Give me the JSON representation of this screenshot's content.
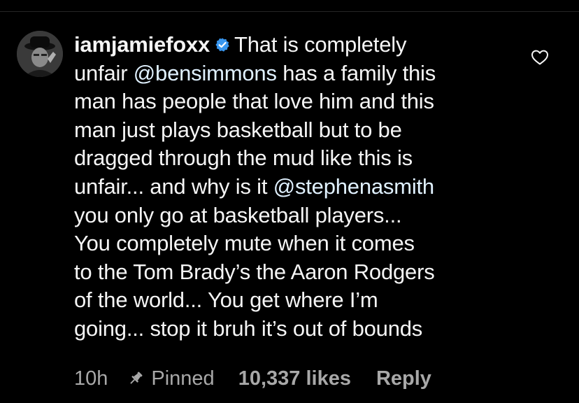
{
  "comment": {
    "username": "iamjamiefoxx",
    "verified_icon": "verified-badge-icon",
    "avatar_icon": "profile-photo",
    "lines": [
      [
        {
          "text": "That is completely"
        }
      ],
      [
        {
          "text": "unfair "
        },
        {
          "text": "@bensimmons",
          "mention": true
        },
        {
          "text": " has a family this"
        }
      ],
      [
        {
          "text": "man has people that love him and this"
        }
      ],
      [
        {
          "text": "man just plays basketball but to be"
        }
      ],
      [
        {
          "text": "dragged through the mud like this is"
        }
      ],
      [
        {
          "text": "unfair... and why is it "
        },
        {
          "text": "@stephenasmith",
          "mention": true
        }
      ],
      [
        {
          "text": "you only go at basketball players..."
        }
      ],
      [
        {
          "text": "You completely mute when it comes"
        }
      ],
      [
        {
          "text": "to the Tom Brady’s the Aaron Rodgers"
        }
      ],
      [
        {
          "text": "of the world... You get where I’m"
        }
      ],
      [
        {
          "text": "going...  stop it bruh it’s out of bounds"
        }
      ]
    ]
  },
  "meta": {
    "time": "10h",
    "pin_icon": "pin-icon",
    "pinned_label": "Pinned",
    "likes_label": "10,337 likes",
    "reply_label": "Reply"
  },
  "actions": {
    "like_icon": "heart-outline-icon"
  },
  "colors": {
    "background": "#000000",
    "text": "#f5f5f5",
    "mention": "#e0f1ff",
    "secondary": "#a8a8a8",
    "verified": "#3897f0"
  }
}
